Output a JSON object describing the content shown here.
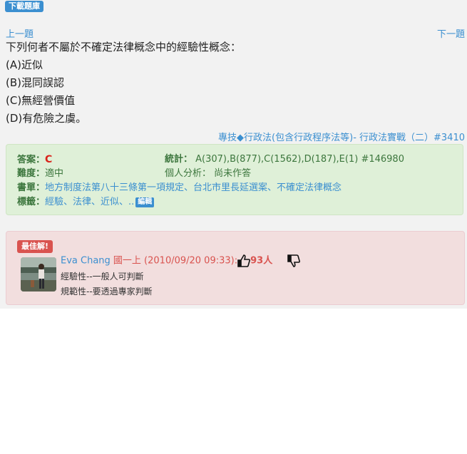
{
  "top": {
    "download_label": "下載題庫"
  },
  "nav": {
    "prev": "上一題",
    "next": "下一題"
  },
  "question": {
    "text": "下列何者不屬於不確定法律概念中的經驗性概念：",
    "options": [
      "(A)近似",
      "(B)混同誤認",
      "(C)無經營價值",
      "(D)有危險之虞。"
    ]
  },
  "breadcrumb": "專技◆行政法(包含行政程序法等)- 行政法實戰（二）#3410",
  "info": {
    "answer_label": "答案：",
    "answer": "C",
    "difficulty_label": "難度：",
    "difficulty": "適中",
    "stats_label": "統計：",
    "stats": "A(307),B(877),C(1562),D(187),E(1) #146980",
    "personal_label": "個人分析：",
    "personal": "尚未作答",
    "booklist_label": "書單：",
    "booklist": "地方制度法第八十三條第一項規定、台北市里長延選案、不確定法律概念",
    "tags_label": "標籤：",
    "tags": "經驗、法律、近似、..",
    "edit_label": "編輯"
  },
  "comment": {
    "best_label": "最佳解!",
    "author": "Eva Chang",
    "meta": "國一上 (2010/09/20 09:33):",
    "likes": "93人",
    "lines": [
      "經驗性--一般人可判斷",
      "規範性--要透過專家判斷"
    ]
  },
  "colors": {
    "accent": "#3b8fd0",
    "green_bg": "#dff0d8",
    "red_bg": "#f2dede",
    "answer": "#d9231b"
  }
}
